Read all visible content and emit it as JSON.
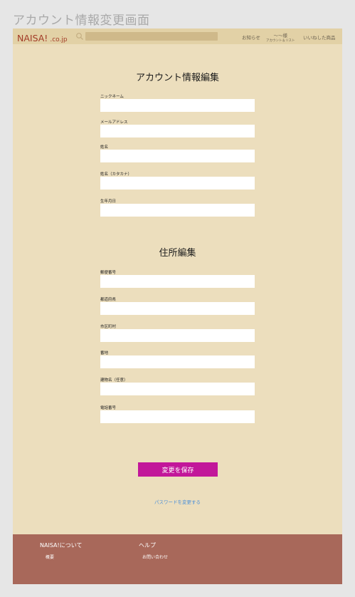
{
  "canvas_title": "アカウント情報変更画面",
  "header": {
    "logo_main": "NAISA!",
    "logo_sub": ".co.jp",
    "search_placeholder": "",
    "nav": {
      "notice": "お知らせ",
      "account_main": "〜〜様",
      "account_sub": "アカウント＆リスト",
      "liked": "いいねした商品"
    }
  },
  "account_section": {
    "title": "アカウント情報編集",
    "fields": [
      {
        "label": "ニックネーム",
        "value": ""
      },
      {
        "label": "メールアドレス",
        "value": ""
      },
      {
        "label": "姓名",
        "value": ""
      },
      {
        "label": "姓名（カタカナ）",
        "value": ""
      },
      {
        "label": "生年月日",
        "value": ""
      }
    ]
  },
  "address_section": {
    "title": "住所編集",
    "fields": [
      {
        "label": "郵便番号",
        "value": ""
      },
      {
        "label": "都道府県",
        "value": ""
      },
      {
        "label": "市区町村",
        "value": ""
      },
      {
        "label": "番地",
        "value": ""
      },
      {
        "label": "建物名（任意）",
        "value": ""
      },
      {
        "label": "電話番号",
        "value": ""
      }
    ]
  },
  "actions": {
    "save_label": "変更を保存",
    "password_link": "パスワードを変更する"
  },
  "footer": {
    "about_heading": "NAISA!について",
    "about_link": "概要",
    "help_heading": "ヘルプ",
    "help_link": "お問い合わせ"
  },
  "colors": {
    "page_background": "#ecdebd",
    "header_background": "#e2d1a6",
    "search_bar": "#cfb98a",
    "logo": "#a23b27",
    "save_button": "#c2179a",
    "link": "#4a8fd9",
    "footer": "#a8685a"
  }
}
